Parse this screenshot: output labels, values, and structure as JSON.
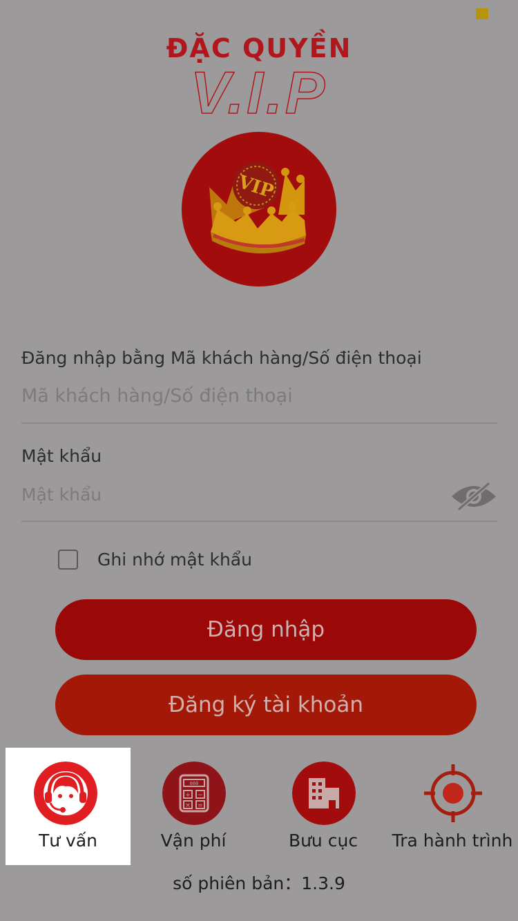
{
  "brand": {
    "title_top": "ĐẶC QUYỀN",
    "title_main": "V.I.P",
    "badge_text": "VIP",
    "accent_color": "#b0161c"
  },
  "login_form": {
    "username_label": "Đăng nhập bằng Mã khách hàng/Số điện thoại",
    "username_placeholder": "Mã khách hàng/Số điện thoại",
    "password_label": "Mật khẩu",
    "password_placeholder": "Mật khẩu",
    "password_toggle_icon": "eye-slash-icon",
    "remember_label": "Ghi nhớ mật khẩu",
    "remember_checked": false
  },
  "buttons": {
    "login": "Đăng nhập",
    "register": "Đăng ký tài khoản"
  },
  "bottom_nav": {
    "items": [
      {
        "label": "Tư vấn",
        "icon": "headset-support-icon",
        "active": true
      },
      {
        "label": "Vận phí",
        "icon": "calculator-icon",
        "active": false
      },
      {
        "label": "Bưu cục",
        "icon": "building-icon",
        "active": false
      },
      {
        "label": "Tra hành trình",
        "icon": "target-locate-icon",
        "active": false
      }
    ]
  },
  "version": {
    "text": "số phiên bản：1.3.9"
  }
}
